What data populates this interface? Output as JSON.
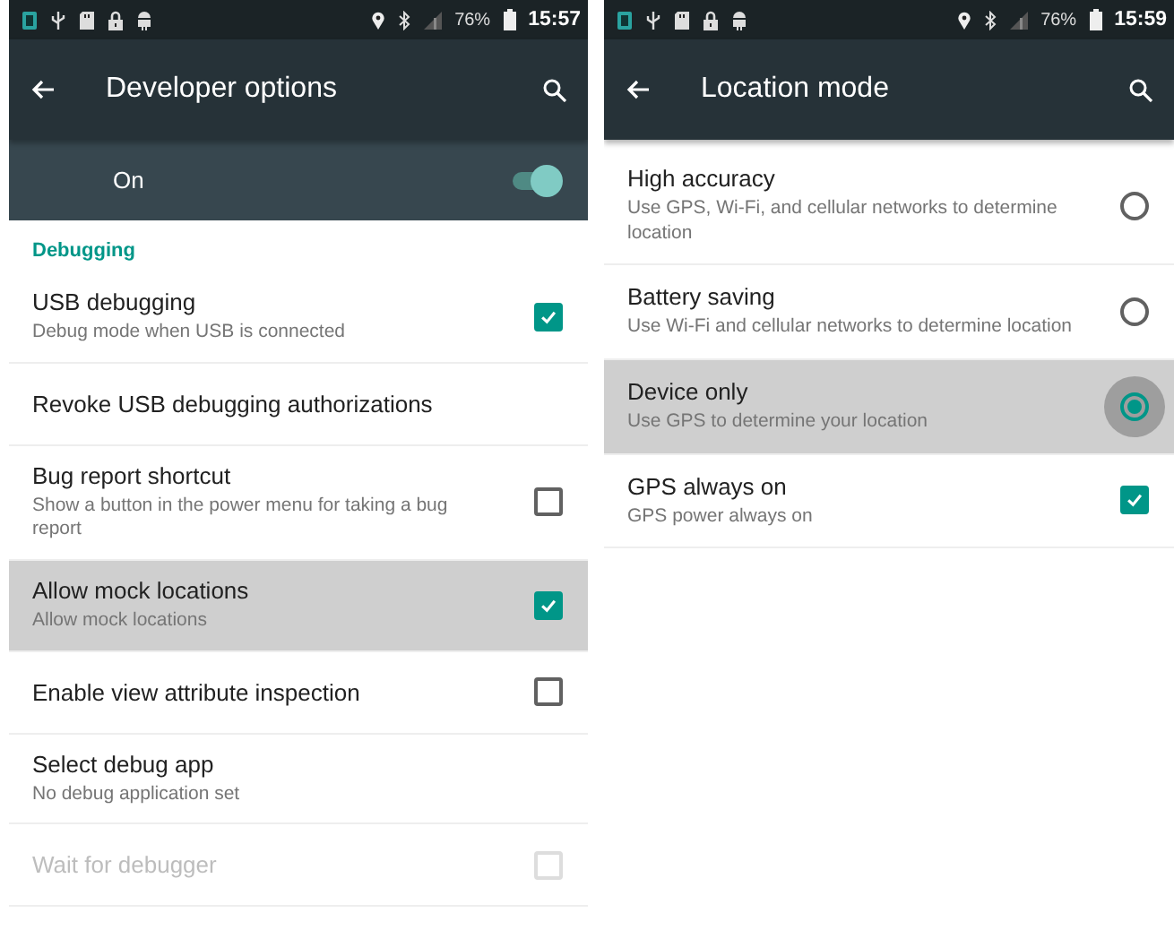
{
  "screens": [
    {
      "status_bar": {
        "battery": "76%",
        "time": "15:57"
      },
      "toolbar": {
        "title": "Developer options"
      },
      "master_switch": {
        "label": "On",
        "on": true
      },
      "items": [
        {
          "kind": "header",
          "title": "Debugging"
        },
        {
          "kind": "checkbox",
          "title": "USB debugging",
          "summary": "Debug mode when USB is connected",
          "checked": true,
          "highlighted": false,
          "disabled": false
        },
        {
          "kind": "plain",
          "title": "Revoke USB debugging authorizations",
          "highlighted": false,
          "disabled": false
        },
        {
          "kind": "checkbox",
          "title": "Bug report shortcut",
          "summary": "Show a button in the power menu for taking a bug report",
          "checked": false,
          "highlighted": false,
          "disabled": false
        },
        {
          "kind": "checkbox",
          "title": "Allow mock locations",
          "summary": "Allow mock locations",
          "checked": true,
          "highlighted": true,
          "disabled": false
        },
        {
          "kind": "checkbox",
          "title": "Enable view attribute inspection",
          "checked": false,
          "highlighted": false,
          "disabled": false
        },
        {
          "kind": "plain",
          "title": "Select debug app",
          "summary": "No debug application set",
          "highlighted": false,
          "disabled": false
        },
        {
          "kind": "checkbox",
          "title": "Wait for debugger",
          "checked": false,
          "highlighted": false,
          "disabled": true
        }
      ]
    },
    {
      "status_bar": {
        "battery": "76%",
        "time": "15:59"
      },
      "toolbar": {
        "title": "Location mode"
      },
      "items": [
        {
          "kind": "radio",
          "title": "High accuracy",
          "summary": "Use GPS, Wi-Fi, and cellular networks to determine location",
          "selected": false,
          "highlighted": false,
          "disabled": false
        },
        {
          "kind": "radio",
          "title": "Battery saving",
          "summary": "Use Wi-Fi and cellular networks to determine location",
          "selected": false,
          "highlighted": false,
          "disabled": false
        },
        {
          "kind": "radio",
          "title": "Device only",
          "summary": "Use GPS to determine your location",
          "selected": true,
          "highlighted": true,
          "disabled": false
        },
        {
          "kind": "checkbox",
          "title": "GPS always on",
          "summary": "GPS power always on",
          "checked": true,
          "highlighted": false,
          "disabled": false
        }
      ]
    }
  ]
}
